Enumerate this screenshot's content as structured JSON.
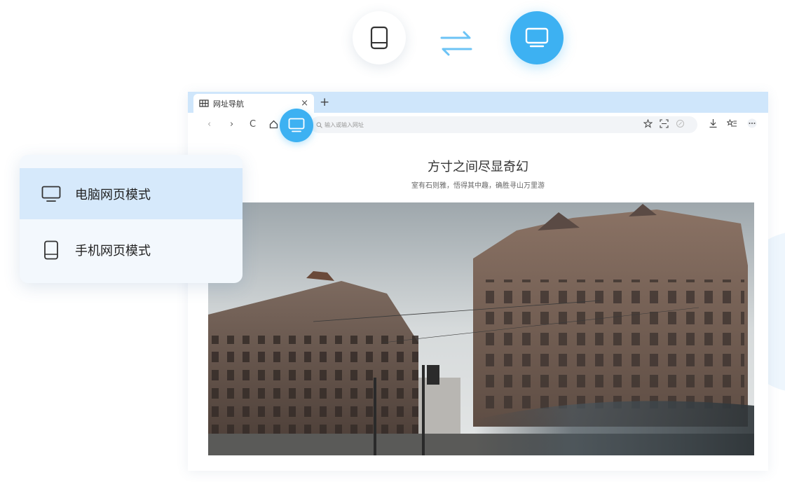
{
  "view_toggle": {
    "mobile_icon": "mobile-icon",
    "swap_icon": "swap-arrows-icon",
    "desktop_icon": "desktop-icon",
    "active": "desktop",
    "accent": "#3db1f2"
  },
  "browser": {
    "tab": {
      "icon": "grid-icon",
      "label": "网址导航"
    },
    "address_bar": {
      "placeholder": "输入或输入网址"
    },
    "page": {
      "title": "方寸之间尽显奇幻",
      "subtitle": "室有石则雅，悟得其中趣，确胜寻山万里游"
    }
  },
  "mode_menu": {
    "items": [
      {
        "icon": "desktop-icon",
        "label": "电脑网页模式",
        "active": true
      },
      {
        "icon": "mobile-icon",
        "label": "手机网页模式",
        "active": false
      }
    ]
  },
  "colors": {
    "tabbar": "#cfe6fb",
    "menu_bg": "#f3f8fd",
    "menu_active": "#d6e9fb"
  }
}
